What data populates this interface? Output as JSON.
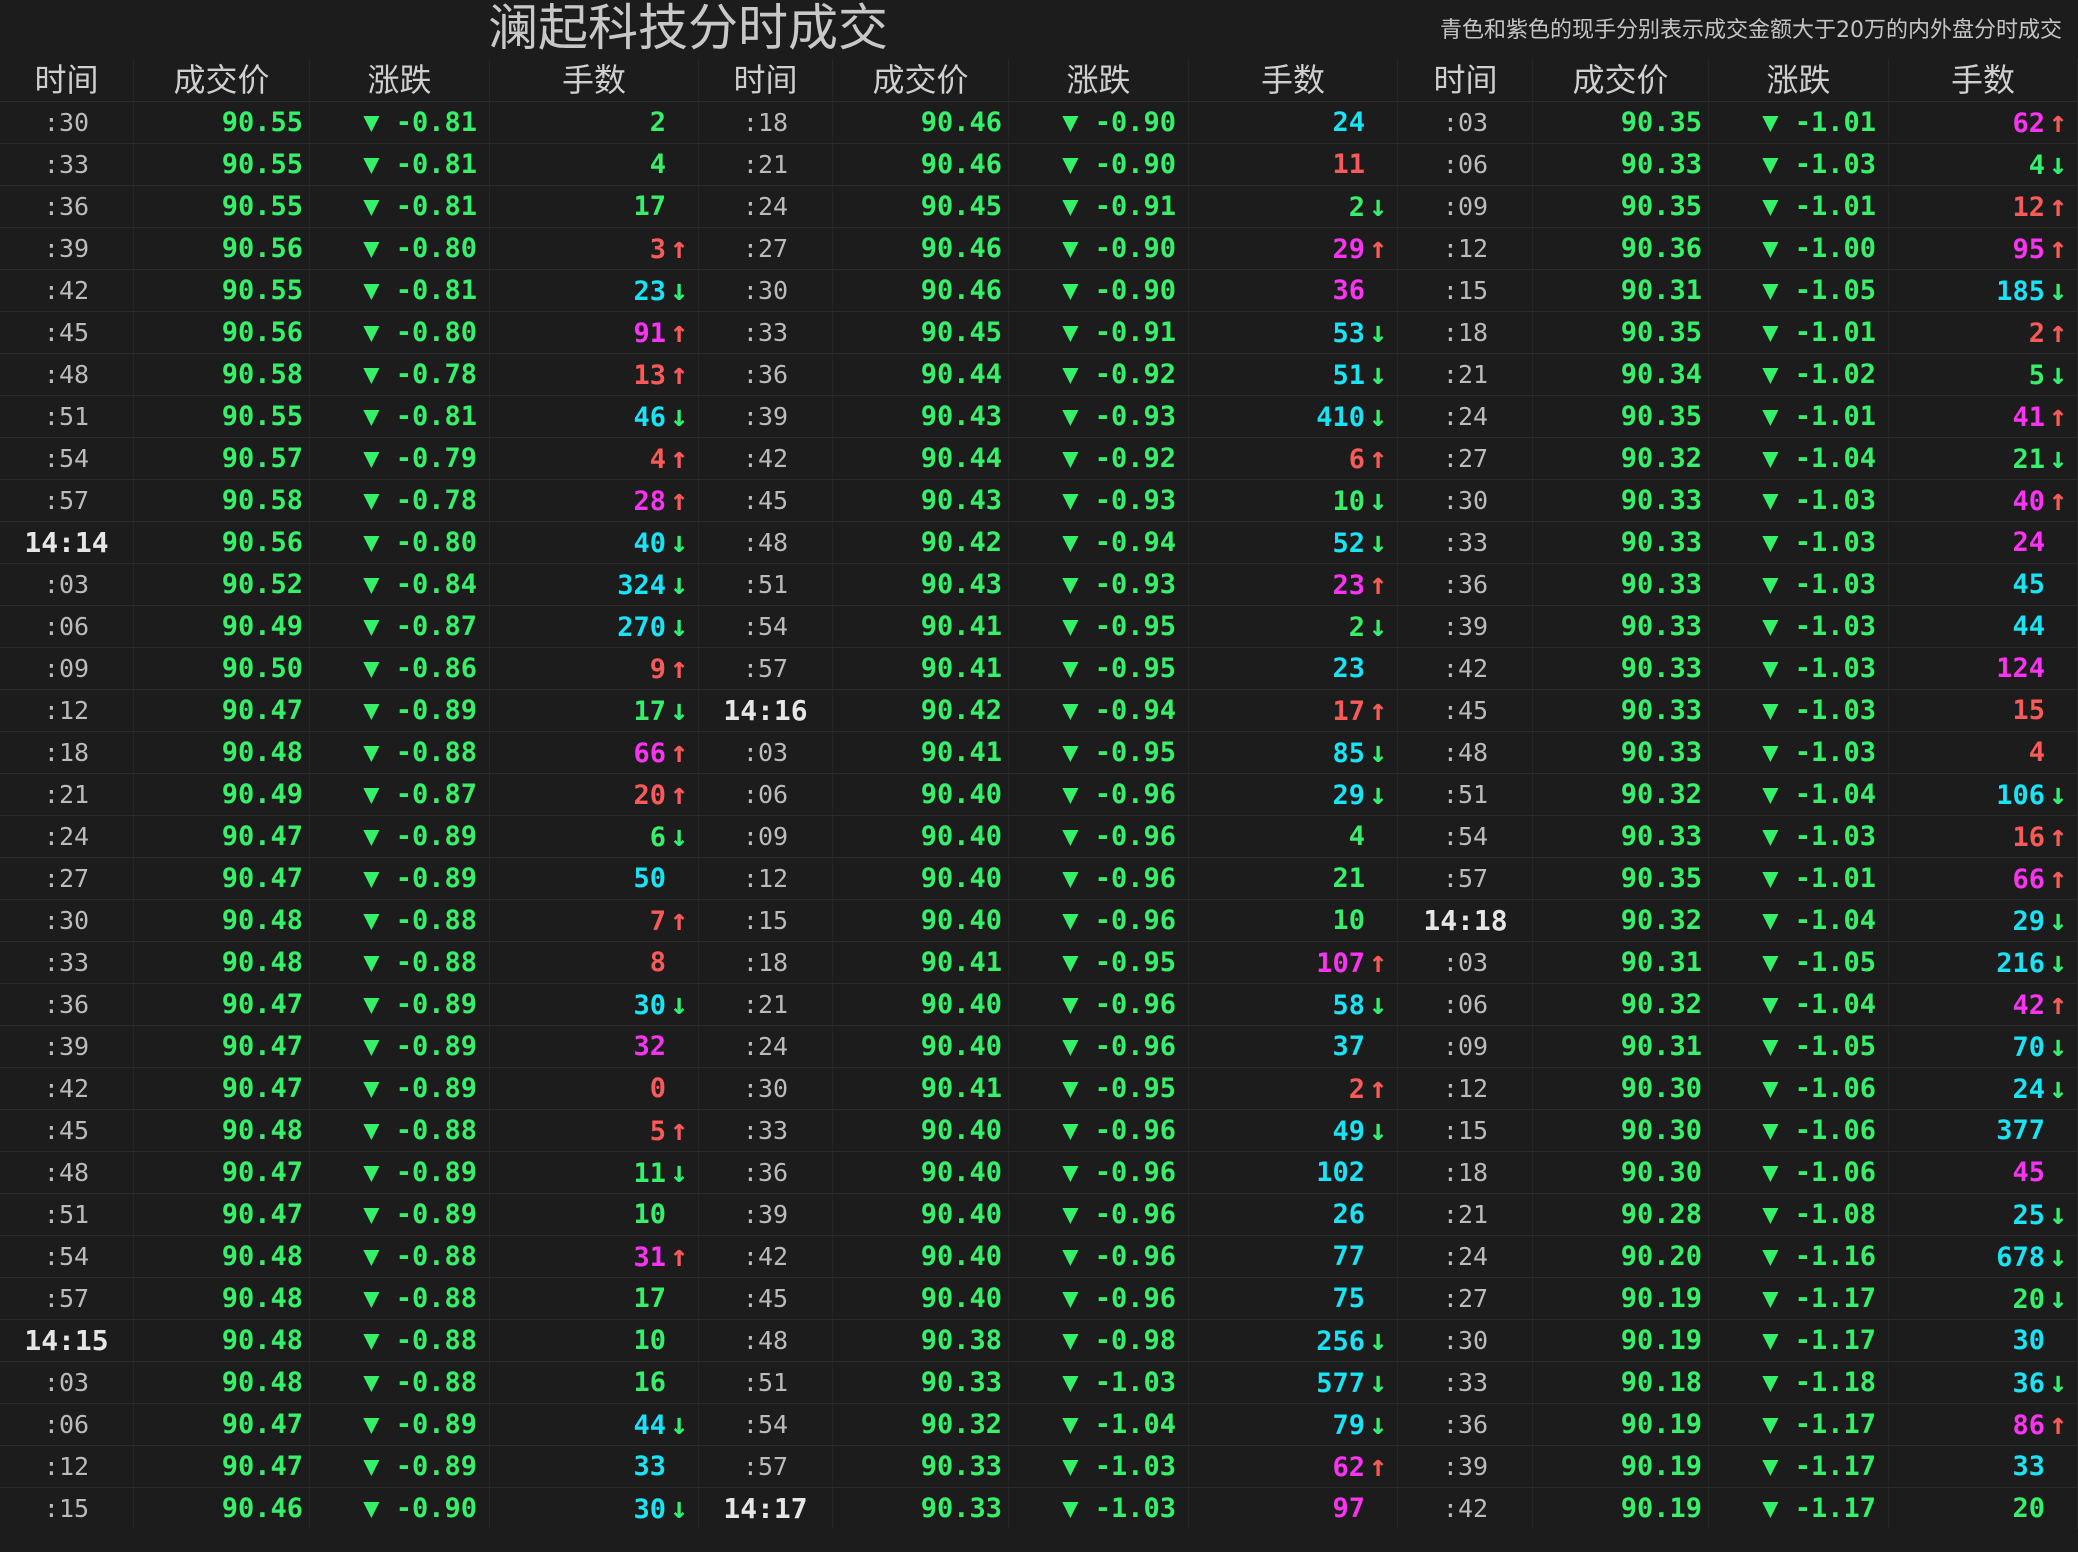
{
  "title": "澜起科技分时成交",
  "note": "青色和紫色的现手分别表示成交金额大于20万的内外盘分时成交",
  "headers": [
    "时间",
    "成交价",
    "涨跌",
    "手数"
  ],
  "colors": {
    "background": "#1c1c1c",
    "price_green": "#36f06a",
    "volume_red": "#ff5a5a",
    "volume_green": "#36f06a",
    "volume_cyan": "#19e3f5",
    "volume_magenta": "#ff33f4",
    "arrow_up": "#ff5a5a",
    "arrow_down": "#2ff070"
  },
  "columns": [
    {
      "rows": [
        {
          "time": ":30",
          "price": "90.55",
          "change": "▼ -0.81",
          "volume": "2",
          "vcolor": "green",
          "arrow": ""
        },
        {
          "time": ":33",
          "price": "90.55",
          "change": "▼ -0.81",
          "volume": "4",
          "vcolor": "green",
          "arrow": ""
        },
        {
          "time": ":36",
          "price": "90.55",
          "change": "▼ -0.81",
          "volume": "17",
          "vcolor": "green",
          "arrow": ""
        },
        {
          "time": ":39",
          "price": "90.56",
          "change": "▼ -0.80",
          "volume": "3",
          "vcolor": "red",
          "arrow": "up"
        },
        {
          "time": ":42",
          "price": "90.55",
          "change": "▼ -0.81",
          "volume": "23",
          "vcolor": "cyan",
          "arrow": "down"
        },
        {
          "time": ":45",
          "price": "90.56",
          "change": "▼ -0.80",
          "volume": "91",
          "vcolor": "magenta",
          "arrow": "up"
        },
        {
          "time": ":48",
          "price": "90.58",
          "change": "▼ -0.78",
          "volume": "13",
          "vcolor": "red",
          "arrow": "up"
        },
        {
          "time": ":51",
          "price": "90.55",
          "change": "▼ -0.81",
          "volume": "46",
          "vcolor": "cyan",
          "arrow": "down"
        },
        {
          "time": ":54",
          "price": "90.57",
          "change": "▼ -0.79",
          "volume": "4",
          "vcolor": "red",
          "arrow": "up"
        },
        {
          "time": ":57",
          "price": "90.58",
          "change": "▼ -0.78",
          "volume": "28",
          "vcolor": "magenta",
          "arrow": "up"
        },
        {
          "time": "14:14",
          "price": "90.56",
          "change": "▼ -0.80",
          "volume": "40",
          "vcolor": "cyan",
          "arrow": "down",
          "major": true
        },
        {
          "time": ":03",
          "price": "90.52",
          "change": "▼ -0.84",
          "volume": "324",
          "vcolor": "cyan",
          "arrow": "down"
        },
        {
          "time": ":06",
          "price": "90.49",
          "change": "▼ -0.87",
          "volume": "270",
          "vcolor": "cyan",
          "arrow": "down"
        },
        {
          "time": ":09",
          "price": "90.50",
          "change": "▼ -0.86",
          "volume": "9",
          "vcolor": "red",
          "arrow": "up"
        },
        {
          "time": ":12",
          "price": "90.47",
          "change": "▼ -0.89",
          "volume": "17",
          "vcolor": "green",
          "arrow": "down"
        },
        {
          "time": ":18",
          "price": "90.48",
          "change": "▼ -0.88",
          "volume": "66",
          "vcolor": "magenta",
          "arrow": "up"
        },
        {
          "time": ":21",
          "price": "90.49",
          "change": "▼ -0.87",
          "volume": "20",
          "vcolor": "red",
          "arrow": "up"
        },
        {
          "time": ":24",
          "price": "90.47",
          "change": "▼ -0.89",
          "volume": "6",
          "vcolor": "green",
          "arrow": "down"
        },
        {
          "time": ":27",
          "price": "90.47",
          "change": "▼ -0.89",
          "volume": "50",
          "vcolor": "cyan",
          "arrow": ""
        },
        {
          "time": ":30",
          "price": "90.48",
          "change": "▼ -0.88",
          "volume": "7",
          "vcolor": "red",
          "arrow": "up"
        },
        {
          "time": ":33",
          "price": "90.48",
          "change": "▼ -0.88",
          "volume": "8",
          "vcolor": "red",
          "arrow": ""
        },
        {
          "time": ":36",
          "price": "90.47",
          "change": "▼ -0.89",
          "volume": "30",
          "vcolor": "cyan",
          "arrow": "down"
        },
        {
          "time": ":39",
          "price": "90.47",
          "change": "▼ -0.89",
          "volume": "32",
          "vcolor": "magenta",
          "arrow": ""
        },
        {
          "time": ":42",
          "price": "90.47",
          "change": "▼ -0.89",
          "volume": "0",
          "vcolor": "red",
          "arrow": ""
        },
        {
          "time": ":45",
          "price": "90.48",
          "change": "▼ -0.88",
          "volume": "5",
          "vcolor": "red",
          "arrow": "up"
        },
        {
          "time": ":48",
          "price": "90.47",
          "change": "▼ -0.89",
          "volume": "11",
          "vcolor": "green",
          "arrow": "down"
        },
        {
          "time": ":51",
          "price": "90.47",
          "change": "▼ -0.89",
          "volume": "10",
          "vcolor": "green",
          "arrow": ""
        },
        {
          "time": ":54",
          "price": "90.48",
          "change": "▼ -0.88",
          "volume": "31",
          "vcolor": "magenta",
          "arrow": "up"
        },
        {
          "time": ":57",
          "price": "90.48",
          "change": "▼ -0.88",
          "volume": "17",
          "vcolor": "green",
          "arrow": ""
        },
        {
          "time": "14:15",
          "price": "90.48",
          "change": "▼ -0.88",
          "volume": "10",
          "vcolor": "green",
          "arrow": "",
          "major": true
        },
        {
          "time": ":03",
          "price": "90.48",
          "change": "▼ -0.88",
          "volume": "16",
          "vcolor": "green",
          "arrow": ""
        },
        {
          "time": ":06",
          "price": "90.47",
          "change": "▼ -0.89",
          "volume": "44",
          "vcolor": "cyan",
          "arrow": "down"
        },
        {
          "time": ":12",
          "price": "90.47",
          "change": "▼ -0.89",
          "volume": "33",
          "vcolor": "cyan",
          "arrow": ""
        },
        {
          "time": ":15",
          "price": "90.46",
          "change": "▼ -0.90",
          "volume": "30",
          "vcolor": "cyan",
          "arrow": "down"
        }
      ]
    },
    {
      "rows": [
        {
          "time": ":18",
          "price": "90.46",
          "change": "▼ -0.90",
          "volume": "24",
          "vcolor": "cyan",
          "arrow": ""
        },
        {
          "time": ":21",
          "price": "90.46",
          "change": "▼ -0.90",
          "volume": "11",
          "vcolor": "red",
          "arrow": ""
        },
        {
          "time": ":24",
          "price": "90.45",
          "change": "▼ -0.91",
          "volume": "2",
          "vcolor": "green",
          "arrow": "down"
        },
        {
          "time": ":27",
          "price": "90.46",
          "change": "▼ -0.90",
          "volume": "29",
          "vcolor": "magenta",
          "arrow": "up"
        },
        {
          "time": ":30",
          "price": "90.46",
          "change": "▼ -0.90",
          "volume": "36",
          "vcolor": "magenta",
          "arrow": ""
        },
        {
          "time": ":33",
          "price": "90.45",
          "change": "▼ -0.91",
          "volume": "53",
          "vcolor": "cyan",
          "arrow": "down"
        },
        {
          "time": ":36",
          "price": "90.44",
          "change": "▼ -0.92",
          "volume": "51",
          "vcolor": "cyan",
          "arrow": "down"
        },
        {
          "time": ":39",
          "price": "90.43",
          "change": "▼ -0.93",
          "volume": "410",
          "vcolor": "cyan",
          "arrow": "down"
        },
        {
          "time": ":42",
          "price": "90.44",
          "change": "▼ -0.92",
          "volume": "6",
          "vcolor": "red",
          "arrow": "up"
        },
        {
          "time": ":45",
          "price": "90.43",
          "change": "▼ -0.93",
          "volume": "10",
          "vcolor": "green",
          "arrow": "down"
        },
        {
          "time": ":48",
          "price": "90.42",
          "change": "▼ -0.94",
          "volume": "52",
          "vcolor": "cyan",
          "arrow": "down"
        },
        {
          "time": ":51",
          "price": "90.43",
          "change": "▼ -0.93",
          "volume": "23",
          "vcolor": "magenta",
          "arrow": "up"
        },
        {
          "time": ":54",
          "price": "90.41",
          "change": "▼ -0.95",
          "volume": "2",
          "vcolor": "green",
          "arrow": "down"
        },
        {
          "time": ":57",
          "price": "90.41",
          "change": "▼ -0.95",
          "volume": "23",
          "vcolor": "cyan",
          "arrow": ""
        },
        {
          "time": "14:16",
          "price": "90.42",
          "change": "▼ -0.94",
          "volume": "17",
          "vcolor": "red",
          "arrow": "up",
          "major": true
        },
        {
          "time": ":03",
          "price": "90.41",
          "change": "▼ -0.95",
          "volume": "85",
          "vcolor": "cyan",
          "arrow": "down"
        },
        {
          "time": ":06",
          "price": "90.40",
          "change": "▼ -0.96",
          "volume": "29",
          "vcolor": "cyan",
          "arrow": "down"
        },
        {
          "time": ":09",
          "price": "90.40",
          "change": "▼ -0.96",
          "volume": "4",
          "vcolor": "green",
          "arrow": ""
        },
        {
          "time": ":12",
          "price": "90.40",
          "change": "▼ -0.96",
          "volume": "21",
          "vcolor": "green",
          "arrow": ""
        },
        {
          "time": ":15",
          "price": "90.40",
          "change": "▼ -0.96",
          "volume": "10",
          "vcolor": "green",
          "arrow": ""
        },
        {
          "time": ":18",
          "price": "90.41",
          "change": "▼ -0.95",
          "volume": "107",
          "vcolor": "magenta",
          "arrow": "up"
        },
        {
          "time": ":21",
          "price": "90.40",
          "change": "▼ -0.96",
          "volume": "58",
          "vcolor": "cyan",
          "arrow": "down"
        },
        {
          "time": ":24",
          "price": "90.40",
          "change": "▼ -0.96",
          "volume": "37",
          "vcolor": "cyan",
          "arrow": ""
        },
        {
          "time": ":30",
          "price": "90.41",
          "change": "▼ -0.95",
          "volume": "2",
          "vcolor": "red",
          "arrow": "up"
        },
        {
          "time": ":33",
          "price": "90.40",
          "change": "▼ -0.96",
          "volume": "49",
          "vcolor": "cyan",
          "arrow": "down"
        },
        {
          "time": ":36",
          "price": "90.40",
          "change": "▼ -0.96",
          "volume": "102",
          "vcolor": "cyan",
          "arrow": ""
        },
        {
          "time": ":39",
          "price": "90.40",
          "change": "▼ -0.96",
          "volume": "26",
          "vcolor": "cyan",
          "arrow": ""
        },
        {
          "time": ":42",
          "price": "90.40",
          "change": "▼ -0.96",
          "volume": "77",
          "vcolor": "cyan",
          "arrow": ""
        },
        {
          "time": ":45",
          "price": "90.40",
          "change": "▼ -0.96",
          "volume": "75",
          "vcolor": "cyan",
          "arrow": ""
        },
        {
          "time": ":48",
          "price": "90.38",
          "change": "▼ -0.98",
          "volume": "256",
          "vcolor": "cyan",
          "arrow": "down"
        },
        {
          "time": ":51",
          "price": "90.33",
          "change": "▼ -1.03",
          "volume": "577",
          "vcolor": "cyan",
          "arrow": "down"
        },
        {
          "time": ":54",
          "price": "90.32",
          "change": "▼ -1.04",
          "volume": "79",
          "vcolor": "cyan",
          "arrow": "down"
        },
        {
          "time": ":57",
          "price": "90.33",
          "change": "▼ -1.03",
          "volume": "62",
          "vcolor": "magenta",
          "arrow": "up"
        },
        {
          "time": "14:17",
          "price": "90.33",
          "change": "▼ -1.03",
          "volume": "97",
          "vcolor": "magenta",
          "arrow": "",
          "major": true
        }
      ]
    },
    {
      "rows": [
        {
          "time": ":03",
          "price": "90.35",
          "change": "▼ -1.01",
          "volume": "62",
          "vcolor": "magenta",
          "arrow": "up"
        },
        {
          "time": ":06",
          "price": "90.33",
          "change": "▼ -1.03",
          "volume": "4",
          "vcolor": "green",
          "arrow": "down"
        },
        {
          "time": ":09",
          "price": "90.35",
          "change": "▼ -1.01",
          "volume": "12",
          "vcolor": "red",
          "arrow": "up"
        },
        {
          "time": ":12",
          "price": "90.36",
          "change": "▼ -1.00",
          "volume": "95",
          "vcolor": "magenta",
          "arrow": "up"
        },
        {
          "time": ":15",
          "price": "90.31",
          "change": "▼ -1.05",
          "volume": "185",
          "vcolor": "cyan",
          "arrow": "down"
        },
        {
          "time": ":18",
          "price": "90.35",
          "change": "▼ -1.01",
          "volume": "2",
          "vcolor": "red",
          "arrow": "up"
        },
        {
          "time": ":21",
          "price": "90.34",
          "change": "▼ -1.02",
          "volume": "5",
          "vcolor": "green",
          "arrow": "down"
        },
        {
          "time": ":24",
          "price": "90.35",
          "change": "▼ -1.01",
          "volume": "41",
          "vcolor": "magenta",
          "arrow": "up"
        },
        {
          "time": ":27",
          "price": "90.32",
          "change": "▼ -1.04",
          "volume": "21",
          "vcolor": "green",
          "arrow": "down"
        },
        {
          "time": ":30",
          "price": "90.33",
          "change": "▼ -1.03",
          "volume": "40",
          "vcolor": "magenta",
          "arrow": "up"
        },
        {
          "time": ":33",
          "price": "90.33",
          "change": "▼ -1.03",
          "volume": "24",
          "vcolor": "magenta",
          "arrow": ""
        },
        {
          "time": ":36",
          "price": "90.33",
          "change": "▼ -1.03",
          "volume": "45",
          "vcolor": "cyan",
          "arrow": ""
        },
        {
          "time": ":39",
          "price": "90.33",
          "change": "▼ -1.03",
          "volume": "44",
          "vcolor": "cyan",
          "arrow": ""
        },
        {
          "time": ":42",
          "price": "90.33",
          "change": "▼ -1.03",
          "volume": "124",
          "vcolor": "magenta",
          "arrow": ""
        },
        {
          "time": ":45",
          "price": "90.33",
          "change": "▼ -1.03",
          "volume": "15",
          "vcolor": "red",
          "arrow": ""
        },
        {
          "time": ":48",
          "price": "90.33",
          "change": "▼ -1.03",
          "volume": "4",
          "vcolor": "red",
          "arrow": ""
        },
        {
          "time": ":51",
          "price": "90.32",
          "change": "▼ -1.04",
          "volume": "106",
          "vcolor": "cyan",
          "arrow": "down"
        },
        {
          "time": ":54",
          "price": "90.33",
          "change": "▼ -1.03",
          "volume": "16",
          "vcolor": "red",
          "arrow": "up"
        },
        {
          "time": ":57",
          "price": "90.35",
          "change": "▼ -1.01",
          "volume": "66",
          "vcolor": "magenta",
          "arrow": "up"
        },
        {
          "time": "14:18",
          "price": "90.32",
          "change": "▼ -1.04",
          "volume": "29",
          "vcolor": "cyan",
          "arrow": "down",
          "major": true
        },
        {
          "time": ":03",
          "price": "90.31",
          "change": "▼ -1.05",
          "volume": "216",
          "vcolor": "cyan",
          "arrow": "down"
        },
        {
          "time": ":06",
          "price": "90.32",
          "change": "▼ -1.04",
          "volume": "42",
          "vcolor": "magenta",
          "arrow": "up"
        },
        {
          "time": ":09",
          "price": "90.31",
          "change": "▼ -1.05",
          "volume": "70",
          "vcolor": "cyan",
          "arrow": "down"
        },
        {
          "time": ":12",
          "price": "90.30",
          "change": "▼ -1.06",
          "volume": "24",
          "vcolor": "cyan",
          "arrow": "down"
        },
        {
          "time": ":15",
          "price": "90.30",
          "change": "▼ -1.06",
          "volume": "377",
          "vcolor": "cyan",
          "arrow": ""
        },
        {
          "time": ":18",
          "price": "90.30",
          "change": "▼ -1.06",
          "volume": "45",
          "vcolor": "magenta",
          "arrow": ""
        },
        {
          "time": ":21",
          "price": "90.28",
          "change": "▼ -1.08",
          "volume": "25",
          "vcolor": "cyan",
          "arrow": "down"
        },
        {
          "time": ":24",
          "price": "90.20",
          "change": "▼ -1.16",
          "volume": "678",
          "vcolor": "cyan",
          "arrow": "down"
        },
        {
          "time": ":27",
          "price": "90.19",
          "change": "▼ -1.17",
          "volume": "20",
          "vcolor": "green",
          "arrow": "down"
        },
        {
          "time": ":30",
          "price": "90.19",
          "change": "▼ -1.17",
          "volume": "30",
          "vcolor": "cyan",
          "arrow": ""
        },
        {
          "time": ":33",
          "price": "90.18",
          "change": "▼ -1.18",
          "volume": "36",
          "vcolor": "cyan",
          "arrow": "down"
        },
        {
          "time": ":36",
          "price": "90.19",
          "change": "▼ -1.17",
          "volume": "86",
          "vcolor": "magenta",
          "arrow": "up"
        },
        {
          "time": ":39",
          "price": "90.19",
          "change": "▼ -1.17",
          "volume": "33",
          "vcolor": "cyan",
          "arrow": ""
        },
        {
          "time": ":42",
          "price": "90.19",
          "change": "▼ -1.17",
          "volume": "20",
          "vcolor": "green",
          "arrow": ""
        }
      ]
    }
  ]
}
